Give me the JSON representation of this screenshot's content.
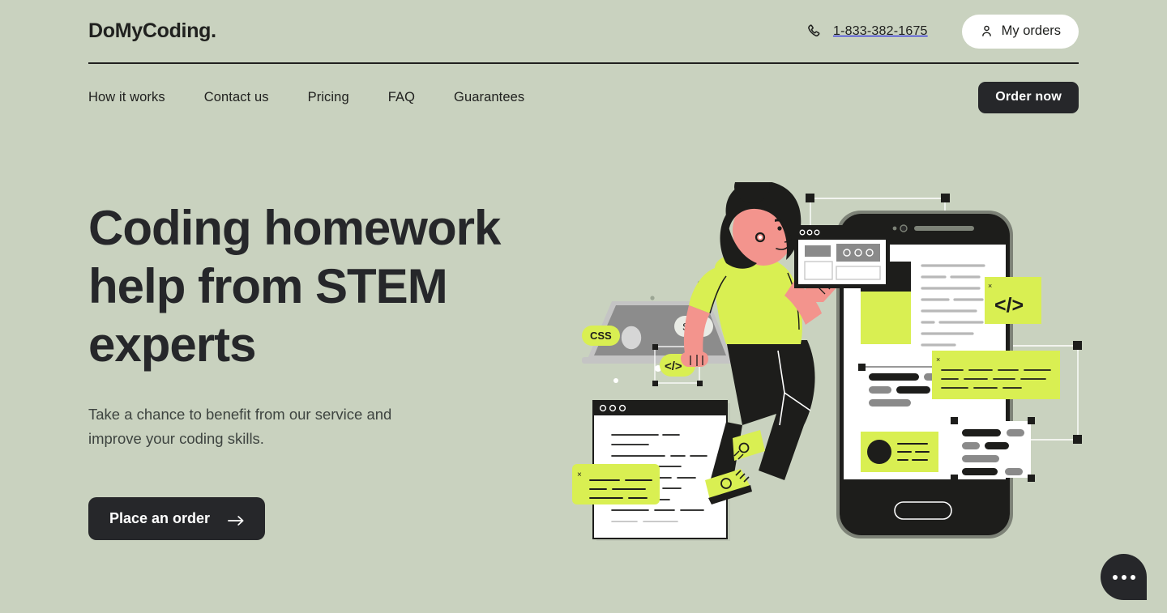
{
  "brand": {
    "logo": "DoMyCoding.",
    "accent_lime": "#d9ef52",
    "accent_dark": "#26272a",
    "background": "#c9d2bf"
  },
  "header": {
    "phone_icon": "phone-icon",
    "phone": "1-833-382-1675",
    "my_orders_label": "My orders",
    "user_icon": "user-icon"
  },
  "nav": {
    "links": [
      {
        "label": "How it works"
      },
      {
        "label": "Contact us"
      },
      {
        "label": "Pricing"
      },
      {
        "label": "FAQ"
      },
      {
        "label": "Guarantees"
      }
    ],
    "order_now_label": "Order now"
  },
  "hero": {
    "title_line1": "Coding homework",
    "title_line2": "help from STEM",
    "title_line3": "experts",
    "subtitle": "Take a chance to benefit from our service and improve your coding skills.",
    "cta_label": "Place an order",
    "cta_icon": "arrow-right-icon"
  },
  "illustration": {
    "name": "developer-hero-illustration",
    "tag_css": "CSS",
    "tag_sql": "SQL",
    "code_badge": "</>",
    "code_card": "</>",
    "close_marks": [
      "×",
      "×",
      "×"
    ]
  },
  "chat": {
    "icon": "chat-dots-icon",
    "dots": [
      "•",
      "•",
      "•"
    ]
  }
}
